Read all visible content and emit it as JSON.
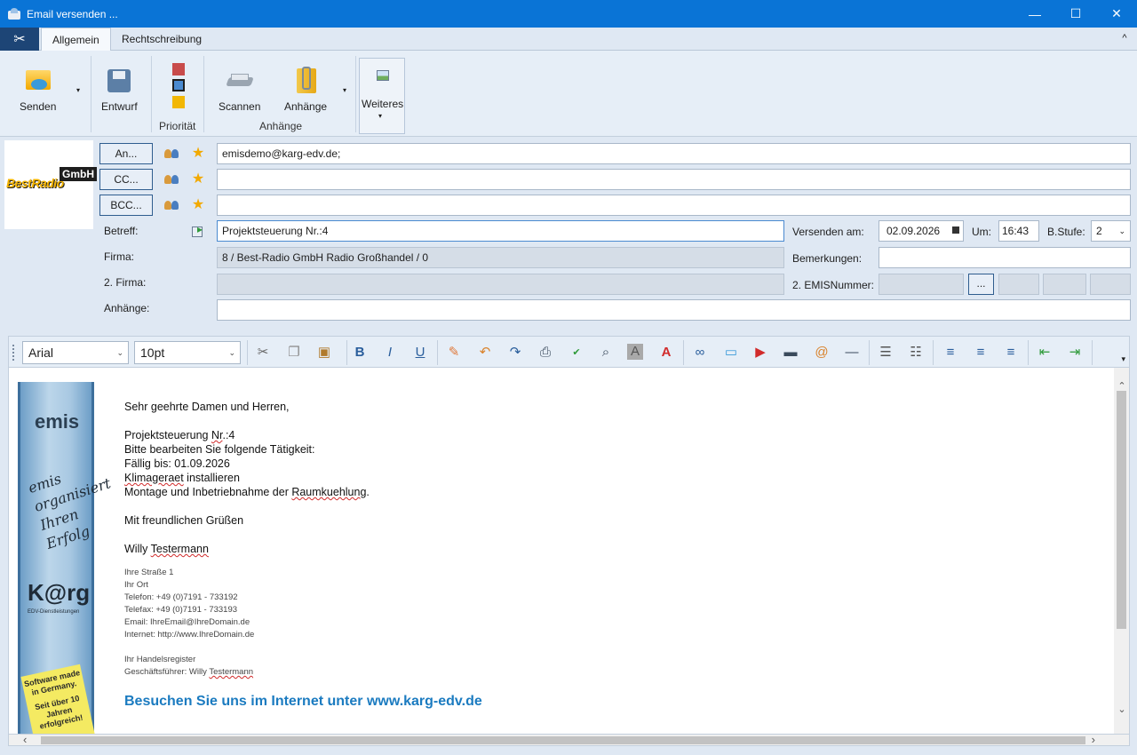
{
  "window": {
    "title": "Email versenden ...",
    "controls": {
      "minimize": "—",
      "maximize": "☐",
      "close": "✕"
    }
  },
  "ribbon_tabs": {
    "file_icon": "tools-icon",
    "tabs": [
      {
        "label": "Allgemein",
        "active": true
      },
      {
        "label": "Rechtschreibung",
        "active": false
      }
    ],
    "collapse": "^"
  },
  "ribbon": {
    "send_label": "Senden",
    "draft_label": "Entwurf",
    "priority_group": "Priorität",
    "priority_colors": [
      "#c84b4b",
      "#4a8ad0",
      "#f2b705"
    ],
    "scan_label": "Scannen",
    "attachments_label": "Anhänge",
    "attachments_group": "Anhänge",
    "more_label": "Weiteres",
    "more_arrow": "▾",
    "drop_arrow": "▾"
  },
  "header": {
    "logo": {
      "text": "BestRadio",
      "badge": "GmbH"
    },
    "to_button": "An...",
    "cc_button": "CC...",
    "bcc_button": "BCC...",
    "to_value": "emisdemo@karg-edv.de;",
    "cc_value": "",
    "bcc_value": "",
    "subject_label": "Betreff:",
    "subject_value": "Projektsteuerung Nr.:4",
    "company_label": "Firma:",
    "company_value": "8 / Best-Radio GmbH Radio Großhandel / 0",
    "company2_label": "2. Firma:",
    "company2_value": "",
    "attachments_label": "Anhänge:",
    "attachments_value": "",
    "send_on_label": "Versenden am:",
    "send_on_value": "02.09.2026",
    "at_label": "Um:",
    "at_value": "16:43",
    "stage_label": "B.Stufe:",
    "stage_value": "2",
    "remarks_label": "Bemerkungen:",
    "remarks_value": "",
    "emis_label": "2. EMISNummer:",
    "emis_button": "..."
  },
  "editor_toolbar": {
    "font": "Arial",
    "size": "10pt",
    "bold": "B",
    "italic": "I",
    "underline": "U",
    "more": "▾"
  },
  "email": {
    "greeting": "Sehr geehrte Damen und Herren,",
    "line1_a": "Projektsteuerung ",
    "line1_b": "Nr",
    "line1_c": ".:4",
    "line2": "Bitte bearbeiten Sie folgende Tätigkeit:",
    "line3": "Fällig bis: 01.09.2026",
    "line4_a": "Klimageraet",
    "line4_b": " installieren",
    "line5_a": "Montage und Inbetriebnahme der ",
    "line5_b": "Raumkuehlung",
    "line5_c": ".",
    "closing": "Mit freundlichen Grüßen",
    "name_a": "Willy ",
    "name_b": "Testermann",
    "street": "Ihre Straße 1",
    "city": "Ihr Ort",
    "phone": "Telefon: +49 (0)7191 - 733192",
    "fax": "Telefax: +49 (0)7191 - 733193",
    "mail": "Email:  IhreEmail@IhreDomain.de",
    "web": "Internet: http://www.IhreDomain.de",
    "register": "Ihr Handelsregister",
    "ceo_a": "Geschäftsführer: Willy ",
    "ceo_b": "Testermann",
    "visit": "Besuchen Sie uns im Internet unter www.karg-edv.de"
  },
  "banner": {
    "brand": "emis",
    "slogan_1": "emis",
    "slogan_2": "organisiert",
    "slogan_3": "Ihren Erfolg",
    "karg": "K@rg",
    "karg_sub": "EDV-Dienstleistungen",
    "sticky_1": "Software made in Germany.",
    "sticky_2": "Seit über 10 Jahren erfolgreich!"
  }
}
